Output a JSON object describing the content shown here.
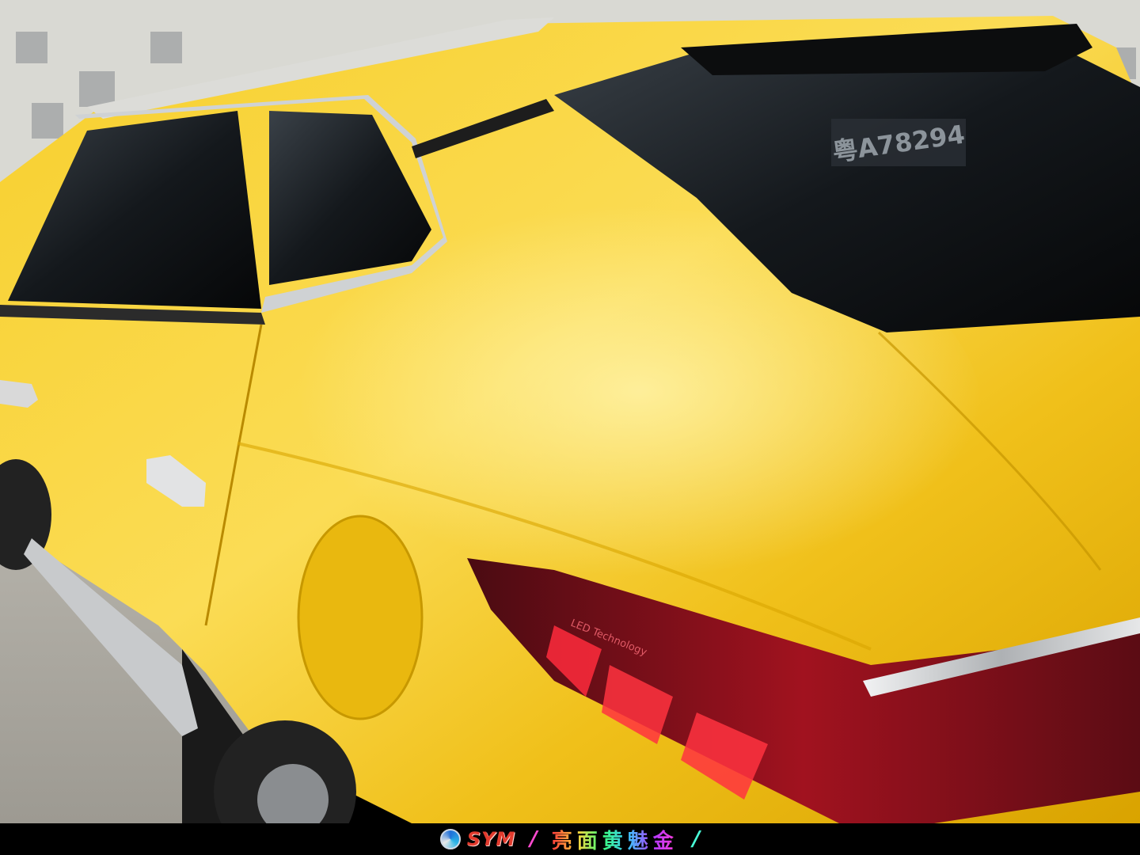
{
  "photo": {
    "subject": "yellow SUV rear quarter",
    "license_plate": "粤A78294",
    "taillight_text": "LED Technology",
    "colors": {
      "body_yellow": "#f2c21a",
      "highlight_yellow": "#fde36a",
      "shadow_yellow": "#c99400",
      "glass": "#14181c",
      "chrome": "#d7d9db",
      "taillight_red": "#b3122a",
      "wall": "#d9d9d3"
    }
  },
  "caption": {
    "brand": "SYM",
    "product_name": "亮面黄魅金",
    "separator_left": "/",
    "separator_right": "/"
  }
}
